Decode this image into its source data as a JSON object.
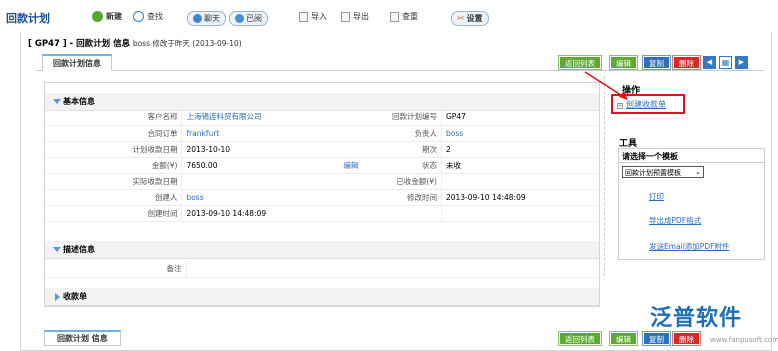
{
  "app": {
    "title": "回款计划"
  },
  "toolbar": {
    "new_label": "新建",
    "search_label": "查找",
    "chat_label": "聊天",
    "read_label": "已阅",
    "import_label": "导入",
    "export_label": "导出",
    "reset_label": "查重",
    "settings_label": "设置"
  },
  "header": {
    "code": "[ GP47 ] - 回款计划 信息",
    "sub": "boss 修改于昨天 (2013-09-10)"
  },
  "tab": {
    "label": "回款计划信息"
  },
  "actions": {
    "back_label": "返回列表",
    "edit_label": "编辑",
    "copy_label": "复制",
    "delete_label": "删除"
  },
  "basic": {
    "title": "基本信息",
    "rows": [
      {
        "l1": "客户名称",
        "v1": "上海锡连科贸有限公司",
        "m": "",
        "l2": "回款计划编号",
        "v2": "GP47"
      },
      {
        "l1": "合同订单",
        "v1": "frankfurt",
        "m": "",
        "l2": "负责人",
        "v2": "boss"
      },
      {
        "l1": "计划收款日期",
        "v1": "2013-10-10",
        "m": "",
        "l2": "期次",
        "v2": "2"
      },
      {
        "l1": "金额(¥)",
        "v1": "7650.00",
        "m": "编辑",
        "l2": "状态",
        "v2": "未收"
      },
      {
        "l1": "实际收款日期",
        "v1": "",
        "m": "",
        "l2": "已收金额(¥)",
        "v2": ""
      },
      {
        "l1": "创建人",
        "v1": "boss",
        "m": "",
        "l2": "修改时间",
        "v2": "2013-09-10 14:48:09"
      },
      {
        "l1": "创建时间",
        "v1": "2013-09-10 14:48:09",
        "m": "",
        "l2": "",
        "v2": ""
      }
    ]
  },
  "desc": {
    "title": "描述信息",
    "note_label": "备注",
    "note_value": ""
  },
  "receipts": {
    "title": "收款单"
  },
  "side": {
    "ops_title": "操作",
    "create_receipt": "创建收款单",
    "tools_title": "工具",
    "template_head": "请选择一个模板",
    "template_value": "回款计划预置模板",
    "print": "打印",
    "export_pdf": "导出成PDF格式",
    "email_pdf": "发送Email添加PDF附件"
  },
  "bottom": {
    "tab_label": "回款计划 信息"
  },
  "logo": {
    "text": "泛普软件",
    "sub": "www.fanpusoft.com"
  }
}
